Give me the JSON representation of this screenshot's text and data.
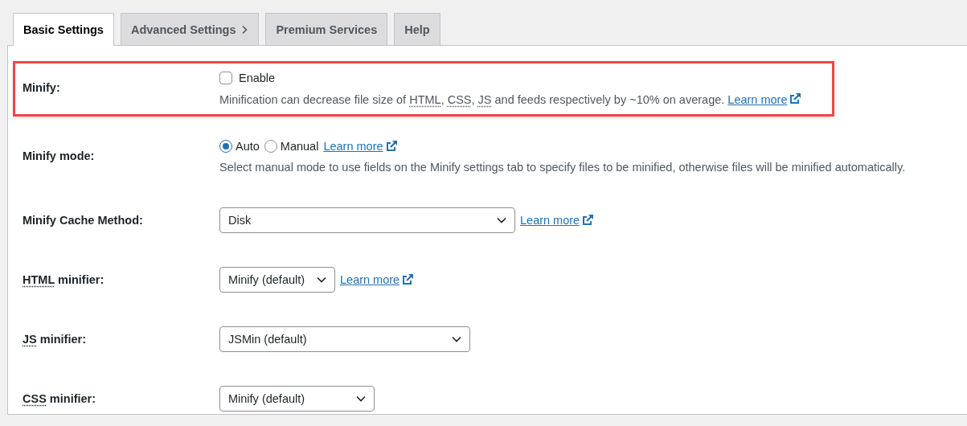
{
  "tabs": [
    {
      "label": "Basic Settings",
      "selected": true,
      "chevron": false
    },
    {
      "label": "Advanced Settings",
      "selected": false,
      "chevron": true
    },
    {
      "label": "Premium Services",
      "selected": false,
      "chevron": false
    },
    {
      "label": "Help",
      "selected": false,
      "chevron": false
    }
  ],
  "rows": [
    {
      "kind": "checkbox",
      "highlighted": true,
      "label": [
        {
          "text": "Minify:",
          "abbr": false
        }
      ],
      "options": [
        {
          "label": "Enable",
          "selected": false
        }
      ],
      "description": [
        {
          "text": "Minification can decrease file size of ",
          "abbr": false
        },
        {
          "text": "HTML",
          "abbr": true
        },
        {
          "text": ", ",
          "abbr": false
        },
        {
          "text": "CSS",
          "abbr": true
        },
        {
          "text": ", ",
          "abbr": false
        },
        {
          "text": "JS",
          "abbr": true
        },
        {
          "text": " and feeds respectively by ~10% on average.",
          "abbr": false
        }
      ],
      "description_link": "Learn more"
    },
    {
      "kind": "radio",
      "highlighted": false,
      "label": [
        {
          "text": "Minify mode:",
          "abbr": false
        }
      ],
      "options": [
        {
          "label": "Auto",
          "selected": true
        },
        {
          "label": "Manual",
          "selected": false
        }
      ],
      "link": "Learn more",
      "description": [
        {
          "text": "Select manual mode to use fields on the Minify settings tab to specify files to be minified, otherwise files will be minified automatically.",
          "abbr": false
        }
      ]
    },
    {
      "kind": "select",
      "highlighted": false,
      "label": [
        {
          "text": "Minify Cache Method:",
          "abbr": false
        }
      ],
      "value": "Disk",
      "link": "Learn more"
    },
    {
      "kind": "select",
      "highlighted": false,
      "label": [
        {
          "text": "HTML",
          "abbr": true
        },
        {
          "text": " minifier:",
          "abbr": false
        }
      ],
      "value": "Minify (default)",
      "link": "Learn more"
    },
    {
      "kind": "select",
      "highlighted": false,
      "label": [
        {
          "text": "JS",
          "abbr": true
        },
        {
          "text": " minifier:",
          "abbr": false
        }
      ],
      "value": "JSMin (default)"
    },
    {
      "kind": "select",
      "highlighted": false,
      "label": [
        {
          "text": "CSS",
          "abbr": true
        },
        {
          "text": " minifier:",
          "abbr": false
        }
      ],
      "value": "Minify (default)"
    }
  ]
}
